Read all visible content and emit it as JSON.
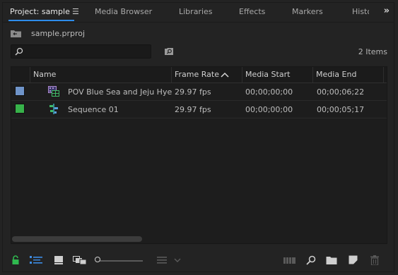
{
  "tabs": {
    "items": [
      {
        "label": "Project: sample"
      },
      {
        "label": "Media Browser"
      },
      {
        "label": "Libraries"
      },
      {
        "label": "Effects"
      },
      {
        "label": "Markers"
      },
      {
        "label": "Histo"
      }
    ],
    "overflow": "»"
  },
  "project": {
    "name": "sample.prproj",
    "search_value": "",
    "search_placeholder": "",
    "items_count": "2 Items"
  },
  "table": {
    "columns": [
      "Name",
      "Frame Rate",
      "Media Start",
      "Media End"
    ],
    "sort_column": "Frame Rate",
    "rows": [
      {
        "label_color": "#6f94c9",
        "icon": "video-clip-icon",
        "name": "POV Blue Sea and Jeju Hye",
        "frame_rate": "29.97 fps",
        "media_start": "00;00;00;00",
        "media_end": "00;00;06;22"
      },
      {
        "label_color": "#37b24a",
        "icon": "sequence-icon",
        "name": "Sequence 01",
        "frame_rate": "29.97 fps",
        "media_start": "00;00;00;00",
        "media_end": "00;00;05;17"
      }
    ]
  },
  "colors": {
    "accent": "#2d8ceb",
    "lock_green": "#2fb94f",
    "list_view_blue": "#3d8de6"
  }
}
